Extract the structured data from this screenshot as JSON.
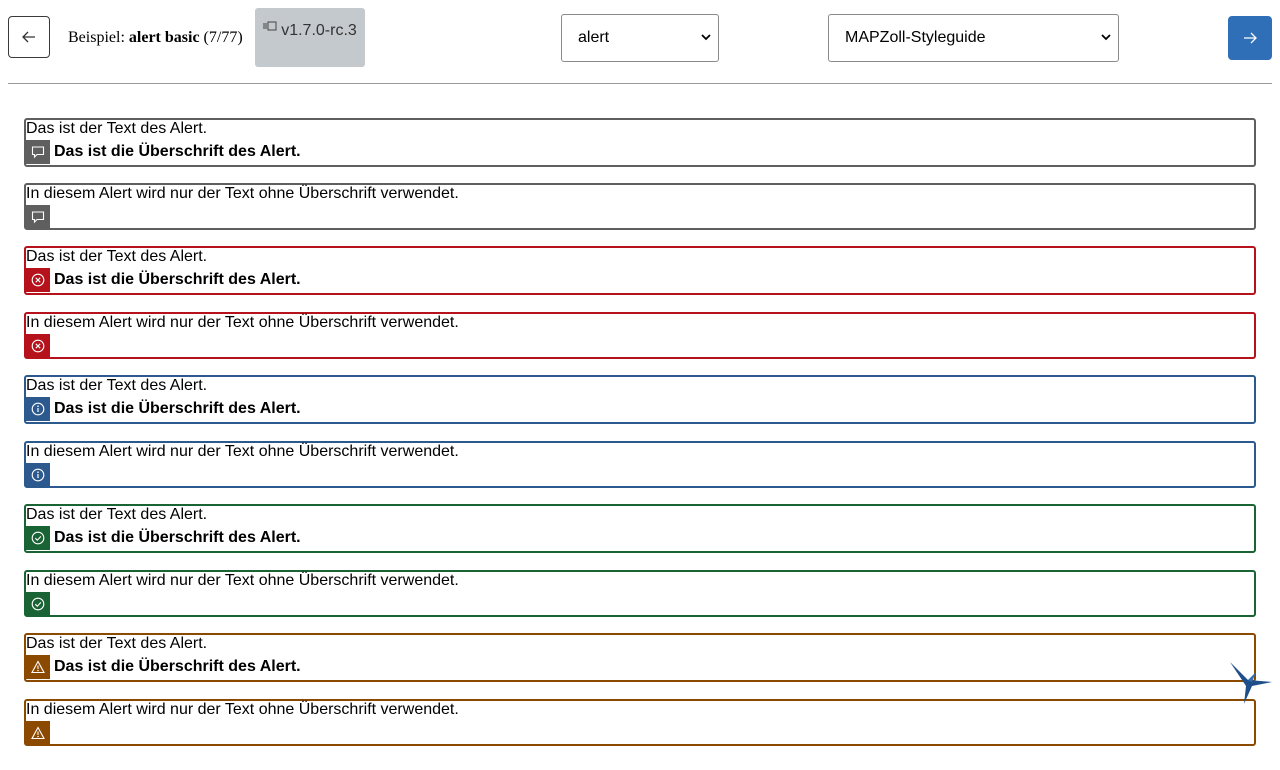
{
  "header": {
    "prev_icon": "arrow-left-icon",
    "next_icon": "arrow-right-icon",
    "example_prefix": "Beispiel:",
    "example_name": "alert basic",
    "example_count": "(7/77)",
    "version_icon": "version-icon",
    "version": "v1.7.0-rc.3",
    "component_select_value": "alert",
    "styleguide_select_value": "MAPZoll-Styleguide"
  },
  "colors": {
    "default": "#5f5f5f",
    "error": "#b5121b",
    "info": "#2d5a8e",
    "success": "#1a6334",
    "warning": "#8b4a00",
    "accent": "#2f6fb8"
  },
  "alerts": [
    {
      "variant": "default",
      "icon": "comment-icon",
      "text": "Das ist der Text des Alert.",
      "heading": "Das ist die Überschrift des Alert."
    },
    {
      "variant": "default",
      "icon": "comment-icon",
      "text": "In diesem Alert wird nur der Text ohne Überschrift verwendet."
    },
    {
      "variant": "error",
      "icon": "error-circle-icon",
      "text": "Das ist der Text des Alert.",
      "heading": "Das ist die Überschrift des Alert."
    },
    {
      "variant": "error",
      "icon": "error-circle-icon",
      "text": "In diesem Alert wird nur der Text ohne Überschrift verwendet."
    },
    {
      "variant": "info",
      "icon": "info-circle-icon",
      "text": "Das ist der Text des Alert.",
      "heading": "Das ist die Überschrift des Alert."
    },
    {
      "variant": "info",
      "icon": "info-circle-icon",
      "text": "In diesem Alert wird nur der Text ohne Überschrift verwendet."
    },
    {
      "variant": "success",
      "icon": "check-circle-icon",
      "text": "Das ist der Text des Alert.",
      "heading": "Das ist die Überschrift des Alert."
    },
    {
      "variant": "success",
      "icon": "check-circle-icon",
      "text": "In diesem Alert wird nur der Text ohne Überschrift verwendet."
    },
    {
      "variant": "warning",
      "icon": "warning-triangle-icon",
      "text": "Das ist der Text des Alert.",
      "heading": "Das ist die Überschrift des Alert."
    },
    {
      "variant": "warning",
      "icon": "warning-triangle-icon",
      "text": "In diesem Alert wird nur der Text ohne Überschrift verwendet."
    }
  ]
}
